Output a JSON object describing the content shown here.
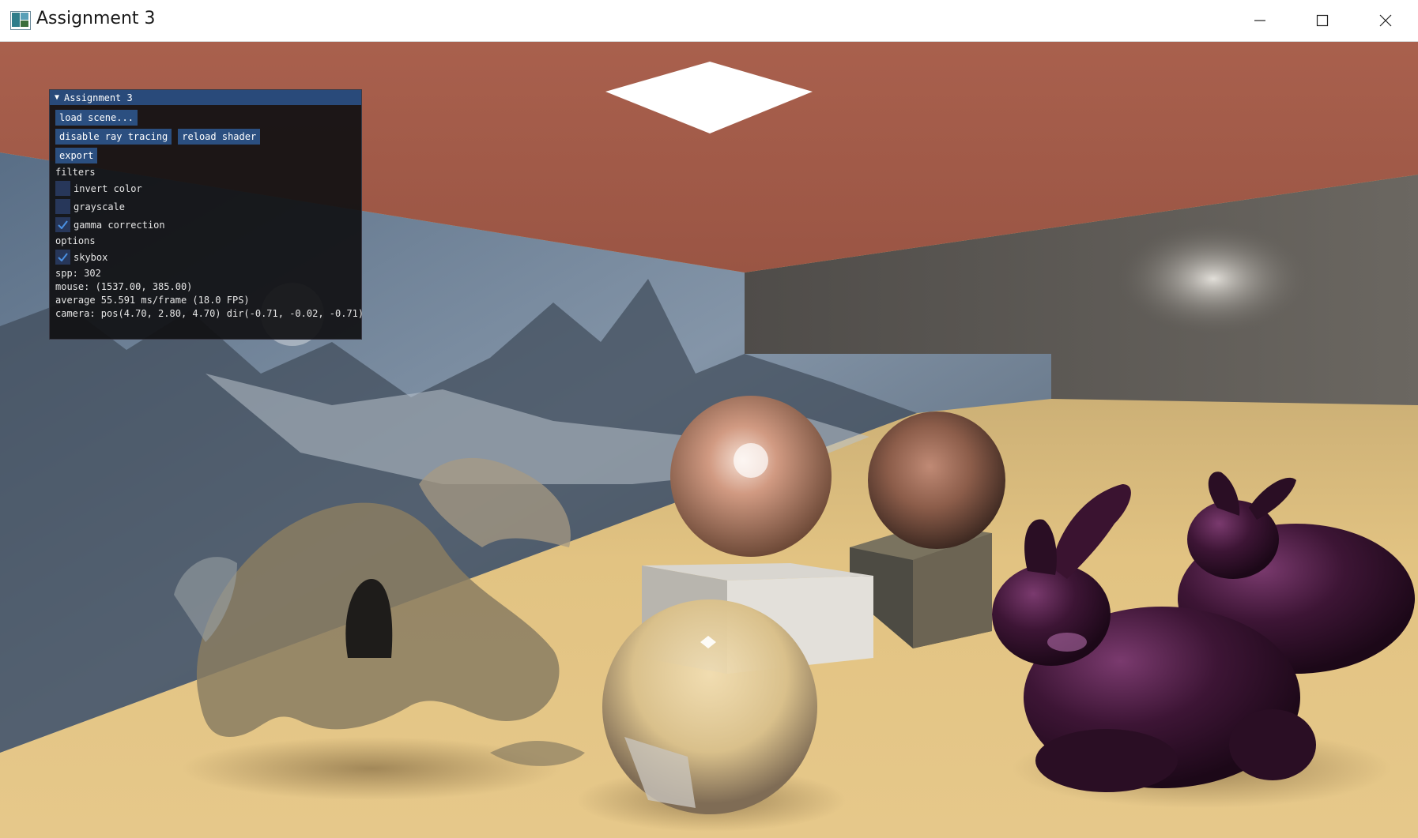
{
  "window": {
    "title": "Assignment 3",
    "icons": {
      "app": "app-icon",
      "minimize": "minimize-icon",
      "maximize": "maximize-icon",
      "close": "close-icon"
    }
  },
  "panel": {
    "title": "Assignment 3",
    "collapse_icon": "triangle-down-icon",
    "buttons": {
      "load_scene": "load scene...",
      "disable_ray_tracing": "disable ray tracing",
      "reload_shader": "reload shader",
      "export": "export"
    },
    "filters_label": "filters",
    "filters": [
      {
        "label": "invert color",
        "checked": false
      },
      {
        "label": "grayscale",
        "checked": false
      },
      {
        "label": "gamma correction",
        "checked": true
      }
    ],
    "options_label": "options",
    "options": [
      {
        "label": "skybox",
        "checked": true
      }
    ],
    "stats": {
      "spp": "spp: 302",
      "mouse": "mouse: (1537.00, 385.00)",
      "average": "average 55.591 ms/frame (18.0 FPS)",
      "camera": "camera: pos(4.70, 2.80, 4.70) dir(-0.71, -0.02, -0.71)"
    },
    "colors": {
      "title_bar": "#294a7a",
      "button": "#2b4f80",
      "check": "#4a90e2"
    }
  },
  "scene": {
    "objects": [
      "ceiling-area-light",
      "skybox-wall",
      "gray-wall",
      "glass-dragon",
      "copper-sphere-left",
      "copper-sphere-right",
      "pedestal-left",
      "pedestal-right",
      "glass-sphere",
      "purple-bunny-front",
      "purple-bunny-back"
    ],
    "colors": {
      "ceiling": "#a55a48",
      "floor": "#e3c382",
      "right_wall": "#5f5b56",
      "sky_wall": "#5a6f85",
      "bunny": "#3a1530",
      "copper": "#c98a6a"
    }
  }
}
